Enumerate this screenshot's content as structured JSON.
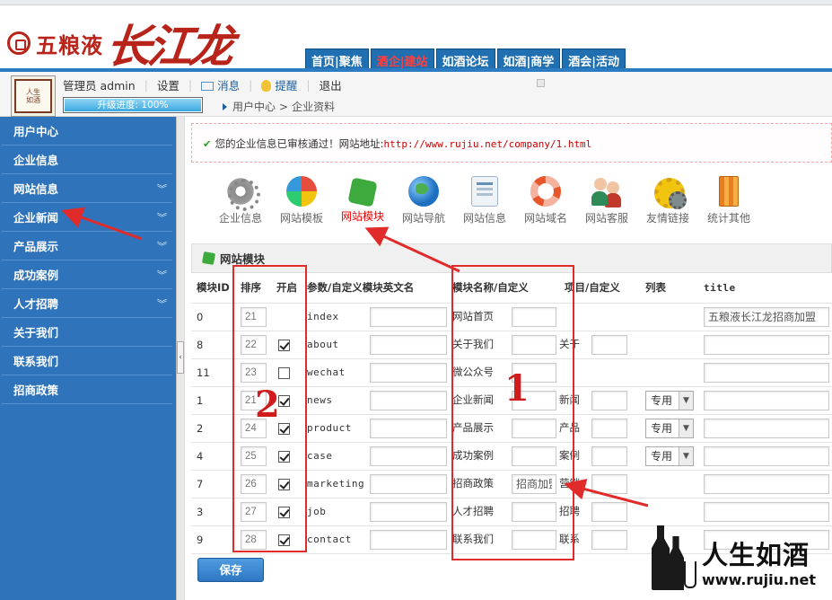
{
  "brand": {
    "logo_small": "五粮液",
    "logo_big": "长江龙"
  },
  "nav": {
    "tabs": [
      "首页|聚焦",
      "酒企|建站",
      "如酒论坛",
      "如酒|商学",
      "酒会|活动"
    ]
  },
  "user": {
    "name": "管理员 admin",
    "settings": "设置",
    "messages": "消息",
    "alerts": "提醒",
    "logout": "退出",
    "progress_label": "升级进度: 100%",
    "progress_value": 1.0
  },
  "breadcrumb": {
    "items": [
      "用户中心",
      "企业资料"
    ],
    "separator": ">"
  },
  "sidebar": {
    "items": [
      {
        "label": "用户中心",
        "expandable": false
      },
      {
        "label": "企业信息",
        "expandable": false
      },
      {
        "label": "网站信息",
        "expandable": true
      },
      {
        "label": "企业新闻",
        "expandable": true
      },
      {
        "label": "产品展示",
        "expandable": true
      },
      {
        "label": "成功案例",
        "expandable": true
      },
      {
        "label": "人才招聘",
        "expandable": true
      },
      {
        "label": "关于我们",
        "expandable": false
      },
      {
        "label": "联系我们",
        "expandable": false
      },
      {
        "label": "招商政策",
        "expandable": false
      }
    ]
  },
  "notice": {
    "text": "您的企业信息已审核通过！网站地址:",
    "url": "http://www.rujiu.net/company/1.html"
  },
  "toolbar": {
    "items": [
      {
        "label": "企业信息",
        "icon": "gear-icon"
      },
      {
        "label": "网站模板",
        "icon": "pie-chart-icon"
      },
      {
        "label": "网站模块",
        "icon": "puzzle-icon",
        "active": true
      },
      {
        "label": "网站导航",
        "icon": "globe-icon"
      },
      {
        "label": "网站信息",
        "icon": "document-icon"
      },
      {
        "label": "网站域名",
        "icon": "lifebuoy-icon"
      },
      {
        "label": "网站客服",
        "icon": "people-icon"
      },
      {
        "label": "友情链接",
        "icon": "gears-icon"
      },
      {
        "label": "统计其他",
        "icon": "bar-chart-icon"
      }
    ]
  },
  "panel": {
    "title": "网站模块",
    "columns": [
      "模块ID",
      "排序",
      "开启",
      "参数/自定义模块英文名",
      "模块名称/自定义",
      "项目/自定义",
      "列表",
      "title"
    ],
    "rows": [
      {
        "id": "0",
        "order": "21",
        "enabled": null,
        "param": "index",
        "name": "网站首页",
        "custom": "",
        "project": "",
        "list": "",
        "title": "五粮液长江龙招商加盟"
      },
      {
        "id": "8",
        "order": "22",
        "enabled": true,
        "param": "about",
        "name": "关于我们",
        "custom": "",
        "project": "关于",
        "list": "",
        "title": ""
      },
      {
        "id": "11",
        "order": "23",
        "enabled": false,
        "param": "wechat",
        "name": "微公众号",
        "custom": "",
        "project": "",
        "list": "",
        "title": ""
      },
      {
        "id": "1",
        "order": "21",
        "enabled": true,
        "param": "news",
        "name": "企业新闻",
        "custom": "",
        "project": "新闻",
        "list": "专用",
        "title": ""
      },
      {
        "id": "2",
        "order": "24",
        "enabled": true,
        "param": "product",
        "name": "产品展示",
        "custom": "",
        "project": "产品",
        "list": "专用",
        "title": ""
      },
      {
        "id": "4",
        "order": "25",
        "enabled": true,
        "param": "case",
        "name": "成功案例",
        "custom": "",
        "project": "案例",
        "list": "专用",
        "title": ""
      },
      {
        "id": "7",
        "order": "26",
        "enabled": true,
        "param": "marketing",
        "name": "招商政策",
        "custom": "招商加盟",
        "project": "营销",
        "list": "",
        "title": ""
      },
      {
        "id": "3",
        "order": "27",
        "enabled": true,
        "param": "job",
        "name": "人才招聘",
        "custom": "",
        "project": "招聘",
        "list": "",
        "title": ""
      },
      {
        "id": "9",
        "order": "28",
        "enabled": true,
        "param": "contact",
        "name": "联系我们",
        "custom": "",
        "project": "联系",
        "list": "",
        "title": ""
      }
    ],
    "save_label": "保存"
  },
  "annotations": {
    "label_1": "1",
    "label_2": "2",
    "color": "#e12b2b"
  },
  "watermark": {
    "text": "人生如酒",
    "url": "www.rujiu.net"
  },
  "colors": {
    "nav_blue": "#1f6fb1",
    "sidebar_blue": "#2f74bb",
    "brand_red": "#b8231a",
    "active_red": "#e00000"
  }
}
